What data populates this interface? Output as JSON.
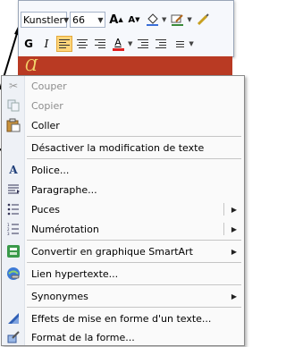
{
  "toolbar": {
    "font_name": "Kunstler",
    "font_size": "66",
    "grow_font_label": "A",
    "shrink_font_label": "A",
    "bold_label": "G",
    "italic_label": "I",
    "font_color_label": "A"
  },
  "slide": {
    "text": "Ɑ"
  },
  "menu": {
    "items": [
      {
        "label": "Couper",
        "icon": "scissors-icon",
        "disabled": true
      },
      {
        "label": "Copier",
        "icon": "copy-icon",
        "disabled": true
      },
      {
        "label": "Coller",
        "icon": "paste-icon",
        "disabled": false
      },
      {
        "label": "Désactiver la modification de texte",
        "icon": "",
        "disabled": false
      },
      {
        "label": "Police...",
        "icon": "font-icon",
        "disabled": false
      },
      {
        "label": "Paragraphe...",
        "icon": "paragraph-icon",
        "disabled": false
      },
      {
        "label": "Puces",
        "icon": "bullets-icon",
        "disabled": false,
        "submenu": true
      },
      {
        "label": "Numérotation",
        "icon": "numbering-icon",
        "disabled": false,
        "submenu": true
      },
      {
        "label": "Convertir en graphique SmartArt",
        "icon": "smartart-icon",
        "disabled": false,
        "submenu": true
      },
      {
        "label": "Lien hypertexte...",
        "icon": "hyperlink-icon",
        "disabled": false
      },
      {
        "label": "Synonymes",
        "icon": "",
        "disabled": false,
        "submenu": true
      },
      {
        "label": "Effets de mise en forme d'un texte...",
        "icon": "text-effects-icon",
        "disabled": false
      },
      {
        "label": "Format de la forme...",
        "icon": "format-shape-icon",
        "disabled": false
      }
    ]
  },
  "colors": {
    "highlight": "#ffd57a",
    "font_color_bar": "#e02020",
    "slide_bg": "#b93a23",
    "menu_gutter": "#eef1f6"
  }
}
